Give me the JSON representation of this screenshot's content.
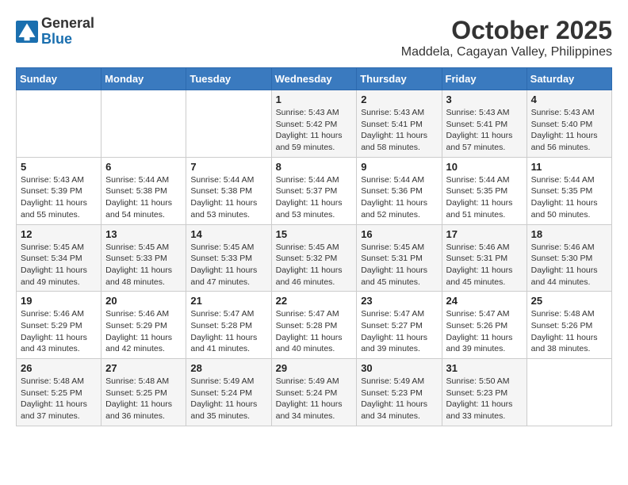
{
  "logo": {
    "general": "General",
    "blue": "Blue"
  },
  "header": {
    "month": "October 2025",
    "location": "Maddela, Cagayan Valley, Philippines"
  },
  "weekdays": [
    "Sunday",
    "Monday",
    "Tuesday",
    "Wednesday",
    "Thursday",
    "Friday",
    "Saturday"
  ],
  "weeks": [
    [
      {
        "day": "",
        "sunrise": "",
        "sunset": "",
        "daylight": ""
      },
      {
        "day": "",
        "sunrise": "",
        "sunset": "",
        "daylight": ""
      },
      {
        "day": "",
        "sunrise": "",
        "sunset": "",
        "daylight": ""
      },
      {
        "day": "1",
        "sunrise": "Sunrise: 5:43 AM",
        "sunset": "Sunset: 5:42 PM",
        "daylight": "Daylight: 11 hours and 59 minutes."
      },
      {
        "day": "2",
        "sunrise": "Sunrise: 5:43 AM",
        "sunset": "Sunset: 5:41 PM",
        "daylight": "Daylight: 11 hours and 58 minutes."
      },
      {
        "day": "3",
        "sunrise": "Sunrise: 5:43 AM",
        "sunset": "Sunset: 5:41 PM",
        "daylight": "Daylight: 11 hours and 57 minutes."
      },
      {
        "day": "4",
        "sunrise": "Sunrise: 5:43 AM",
        "sunset": "Sunset: 5:40 PM",
        "daylight": "Daylight: 11 hours and 56 minutes."
      }
    ],
    [
      {
        "day": "5",
        "sunrise": "Sunrise: 5:43 AM",
        "sunset": "Sunset: 5:39 PM",
        "daylight": "Daylight: 11 hours and 55 minutes."
      },
      {
        "day": "6",
        "sunrise": "Sunrise: 5:44 AM",
        "sunset": "Sunset: 5:38 PM",
        "daylight": "Daylight: 11 hours and 54 minutes."
      },
      {
        "day": "7",
        "sunrise": "Sunrise: 5:44 AM",
        "sunset": "Sunset: 5:38 PM",
        "daylight": "Daylight: 11 hours and 53 minutes."
      },
      {
        "day": "8",
        "sunrise": "Sunrise: 5:44 AM",
        "sunset": "Sunset: 5:37 PM",
        "daylight": "Daylight: 11 hours and 53 minutes."
      },
      {
        "day": "9",
        "sunrise": "Sunrise: 5:44 AM",
        "sunset": "Sunset: 5:36 PM",
        "daylight": "Daylight: 11 hours and 52 minutes."
      },
      {
        "day": "10",
        "sunrise": "Sunrise: 5:44 AM",
        "sunset": "Sunset: 5:35 PM",
        "daylight": "Daylight: 11 hours and 51 minutes."
      },
      {
        "day": "11",
        "sunrise": "Sunrise: 5:44 AM",
        "sunset": "Sunset: 5:35 PM",
        "daylight": "Daylight: 11 hours and 50 minutes."
      }
    ],
    [
      {
        "day": "12",
        "sunrise": "Sunrise: 5:45 AM",
        "sunset": "Sunset: 5:34 PM",
        "daylight": "Daylight: 11 hours and 49 minutes."
      },
      {
        "day": "13",
        "sunrise": "Sunrise: 5:45 AM",
        "sunset": "Sunset: 5:33 PM",
        "daylight": "Daylight: 11 hours and 48 minutes."
      },
      {
        "day": "14",
        "sunrise": "Sunrise: 5:45 AM",
        "sunset": "Sunset: 5:33 PM",
        "daylight": "Daylight: 11 hours and 47 minutes."
      },
      {
        "day": "15",
        "sunrise": "Sunrise: 5:45 AM",
        "sunset": "Sunset: 5:32 PM",
        "daylight": "Daylight: 11 hours and 46 minutes."
      },
      {
        "day": "16",
        "sunrise": "Sunrise: 5:45 AM",
        "sunset": "Sunset: 5:31 PM",
        "daylight": "Daylight: 11 hours and 45 minutes."
      },
      {
        "day": "17",
        "sunrise": "Sunrise: 5:46 AM",
        "sunset": "Sunset: 5:31 PM",
        "daylight": "Daylight: 11 hours and 45 minutes."
      },
      {
        "day": "18",
        "sunrise": "Sunrise: 5:46 AM",
        "sunset": "Sunset: 5:30 PM",
        "daylight": "Daylight: 11 hours and 44 minutes."
      }
    ],
    [
      {
        "day": "19",
        "sunrise": "Sunrise: 5:46 AM",
        "sunset": "Sunset: 5:29 PM",
        "daylight": "Daylight: 11 hours and 43 minutes."
      },
      {
        "day": "20",
        "sunrise": "Sunrise: 5:46 AM",
        "sunset": "Sunset: 5:29 PM",
        "daylight": "Daylight: 11 hours and 42 minutes."
      },
      {
        "day": "21",
        "sunrise": "Sunrise: 5:47 AM",
        "sunset": "Sunset: 5:28 PM",
        "daylight": "Daylight: 11 hours and 41 minutes."
      },
      {
        "day": "22",
        "sunrise": "Sunrise: 5:47 AM",
        "sunset": "Sunset: 5:28 PM",
        "daylight": "Daylight: 11 hours and 40 minutes."
      },
      {
        "day": "23",
        "sunrise": "Sunrise: 5:47 AM",
        "sunset": "Sunset: 5:27 PM",
        "daylight": "Daylight: 11 hours and 39 minutes."
      },
      {
        "day": "24",
        "sunrise": "Sunrise: 5:47 AM",
        "sunset": "Sunset: 5:26 PM",
        "daylight": "Daylight: 11 hours and 39 minutes."
      },
      {
        "day": "25",
        "sunrise": "Sunrise: 5:48 AM",
        "sunset": "Sunset: 5:26 PM",
        "daylight": "Daylight: 11 hours and 38 minutes."
      }
    ],
    [
      {
        "day": "26",
        "sunrise": "Sunrise: 5:48 AM",
        "sunset": "Sunset: 5:25 PM",
        "daylight": "Daylight: 11 hours and 37 minutes."
      },
      {
        "day": "27",
        "sunrise": "Sunrise: 5:48 AM",
        "sunset": "Sunset: 5:25 PM",
        "daylight": "Daylight: 11 hours and 36 minutes."
      },
      {
        "day": "28",
        "sunrise": "Sunrise: 5:49 AM",
        "sunset": "Sunset: 5:24 PM",
        "daylight": "Daylight: 11 hours and 35 minutes."
      },
      {
        "day": "29",
        "sunrise": "Sunrise: 5:49 AM",
        "sunset": "Sunset: 5:24 PM",
        "daylight": "Daylight: 11 hours and 34 minutes."
      },
      {
        "day": "30",
        "sunrise": "Sunrise: 5:49 AM",
        "sunset": "Sunset: 5:23 PM",
        "daylight": "Daylight: 11 hours and 34 minutes."
      },
      {
        "day": "31",
        "sunrise": "Sunrise: 5:50 AM",
        "sunset": "Sunset: 5:23 PM",
        "daylight": "Daylight: 11 hours and 33 minutes."
      },
      {
        "day": "",
        "sunrise": "",
        "sunset": "",
        "daylight": ""
      }
    ]
  ]
}
